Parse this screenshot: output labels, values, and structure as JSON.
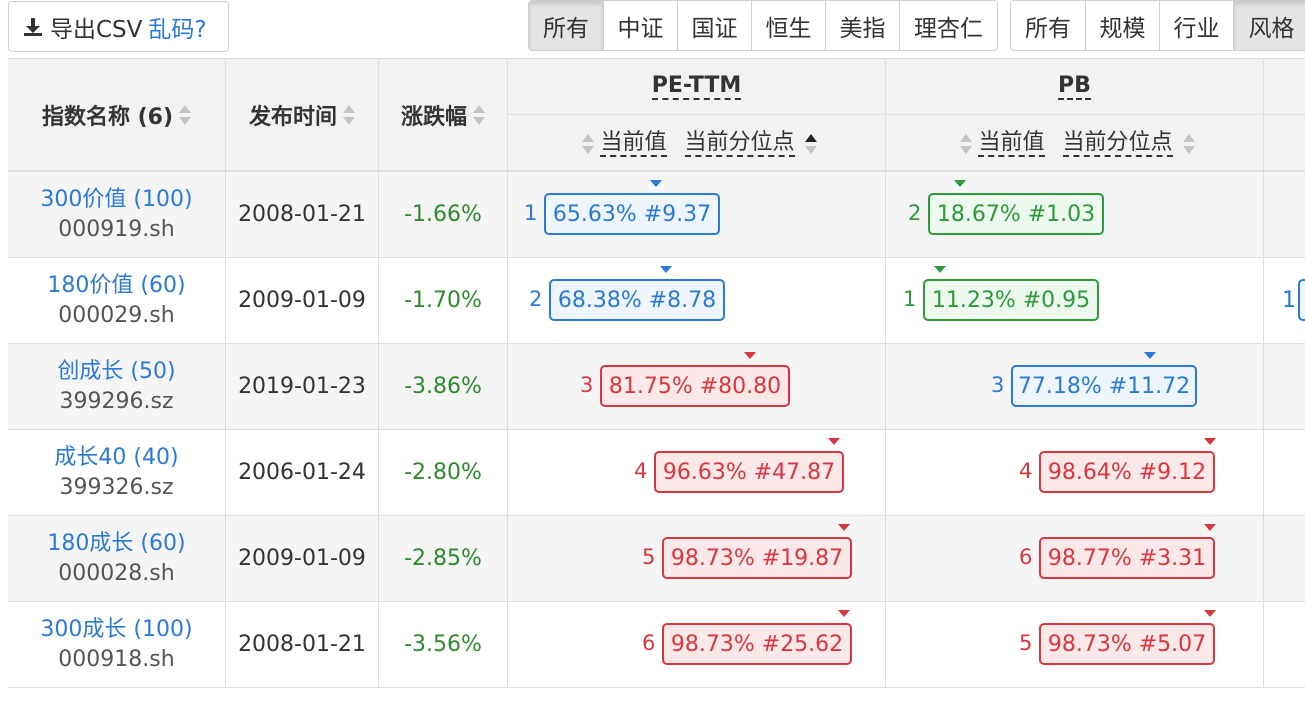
{
  "toolbar": {
    "export_label": "导出CSV",
    "garbled_link": "乱码?",
    "index_group": [
      "所有",
      "中证",
      "国证",
      "恒生",
      "美指",
      "理杏仁"
    ],
    "index_active": 0,
    "type_group": [
      "所有",
      "规模",
      "行业",
      "风格"
    ],
    "type_active": 3
  },
  "table": {
    "headers": {
      "name": "指数名称 (6)",
      "date": "发布时间",
      "change": "涨跌幅",
      "pe": "PE-TTM",
      "pb": "PB",
      "current_value": "当前值",
      "current_percentile": "当前分位点"
    },
    "rows": [
      {
        "name": "300价值 (100)",
        "code": "000919.sh",
        "date": "2008-01-21",
        "change": "-1.66%",
        "pe": {
          "rank": "1",
          "text": "65.63% #9.37",
          "color": "blue"
        },
        "pb": {
          "rank": "2",
          "text": "18.67% #1.03",
          "color": "green"
        },
        "extra": ""
      },
      {
        "name": "180价值 (60)",
        "code": "000029.sh",
        "date": "2009-01-09",
        "change": "-1.70%",
        "pe": {
          "rank": "2",
          "text": "68.38% #8.78",
          "color": "blue"
        },
        "pb": {
          "rank": "1",
          "text": "11.23% #0.95",
          "color": "green"
        },
        "extra": "1"
      },
      {
        "name": "创成长 (50)",
        "code": "399296.sz",
        "date": "2019-01-23",
        "change": "-3.86%",
        "pe": {
          "rank": "3",
          "text": "81.75% #80.80",
          "color": "red"
        },
        "pb": {
          "rank": "3",
          "text": "77.18% #11.72",
          "color": "blue"
        },
        "extra": ""
      },
      {
        "name": "成长40 (40)",
        "code": "399326.sz",
        "date": "2006-01-24",
        "change": "-2.80%",
        "pe": {
          "rank": "4",
          "text": "96.63% #47.87",
          "color": "red"
        },
        "pb": {
          "rank": "4",
          "text": "98.64% #9.12",
          "color": "red"
        },
        "extra": ""
      },
      {
        "name": "180成长 (60)",
        "code": "000028.sh",
        "date": "2009-01-09",
        "change": "-2.85%",
        "pe": {
          "rank": "5",
          "text": "98.73% #19.87",
          "color": "red"
        },
        "pb": {
          "rank": "6",
          "text": "98.77% #3.31",
          "color": "red"
        },
        "extra": ""
      },
      {
        "name": "300成长 (100)",
        "code": "000918.sh",
        "date": "2008-01-21",
        "change": "-3.56%",
        "pe": {
          "rank": "6",
          "text": "98.73% #25.62",
          "color": "red"
        },
        "pb": {
          "rank": "5",
          "text": "98.73% #5.07",
          "color": "red"
        },
        "extra": ""
      }
    ]
  }
}
